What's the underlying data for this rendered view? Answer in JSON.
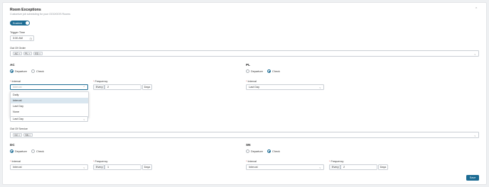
{
  "header": {
    "title": "Room Exceptions",
    "subtitle": "Customize job scheduling for your OOO/OOS Rooms",
    "collapse_icon": "chevron-up-icon"
  },
  "toggle": {
    "label": "Enabled",
    "on": true
  },
  "trigger": {
    "label": "Trigger Time",
    "value": "3:30 AM",
    "icon": "clock-icon"
  },
  "out_of_order": {
    "label": "Out Of Order",
    "tags": [
      "AC",
      "PL",
      "ED"
    ]
  },
  "out_of_service": {
    "label": "Out Of Service",
    "tags": [
      "DC",
      "SN"
    ]
  },
  "radio_labels": {
    "departure": "Departure",
    "check": "Check"
  },
  "field_labels": {
    "interval": "Interval",
    "frequency": "Frequency",
    "every": "Every",
    "days": "Days",
    "required": "*"
  },
  "sections": {
    "ac": {
      "code": "AC",
      "mode": "Departure",
      "interval_value": "",
      "interval_placeholder": "Interval",
      "frequency": "2"
    },
    "pl": {
      "code": "PL",
      "mode": "Check",
      "interval_value": "Last Day"
    },
    "ed": {
      "interval_value": "Last Day"
    },
    "dc": {
      "code": "DC",
      "mode": "Departure",
      "interval_value": "Interval",
      "frequency": "1"
    },
    "sn": {
      "code": "SN",
      "mode": "Check",
      "interval_value": "Interval",
      "frequency": "2"
    }
  },
  "dropdown": {
    "options": [
      "Daily",
      "Interval",
      "Last Day",
      "None"
    ],
    "selected": "Interval"
  },
  "save_label": "Save",
  "colors": {
    "accent": "#1b6b93",
    "border": "#c9ced4",
    "page_bg": "#eef0f2"
  }
}
